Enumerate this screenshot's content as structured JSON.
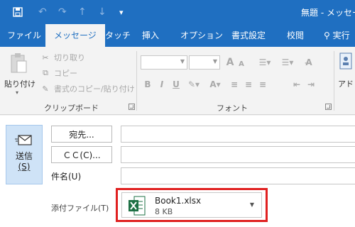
{
  "title": "無題 - メッセー",
  "tabs": [
    "ファイル",
    "メッセージ",
    "タッチ",
    "挿入",
    "オプション",
    "書式設定",
    "校閲",
    "実行"
  ],
  "clipboard": {
    "paste": "貼り付け",
    "cut": "切り取り",
    "copy": "コピー",
    "format_painter": "書式のコピー/貼り付け",
    "group": "クリップボード"
  },
  "font": {
    "group": "フォント",
    "size_up": "A",
    "size_down": "A",
    "bold": "B",
    "italic": "I",
    "underline": "U"
  },
  "names": {
    "address_book": "アドレ"
  },
  "form": {
    "send": "送信",
    "send_key": "(S)",
    "to": "宛先...",
    "cc": "ＣＣ(C)...",
    "subject": "件名(U)",
    "attachment_label": "添付ファイル(T)"
  },
  "attachment": {
    "file_name": "Book1.xlsx",
    "file_size": "8 KB"
  },
  "colors": {
    "ribbon_blue": "#1f6fc1",
    "send_bg": "#cfe3f7",
    "highlight_red": "#e02020",
    "excel_green": "#1d7044"
  }
}
